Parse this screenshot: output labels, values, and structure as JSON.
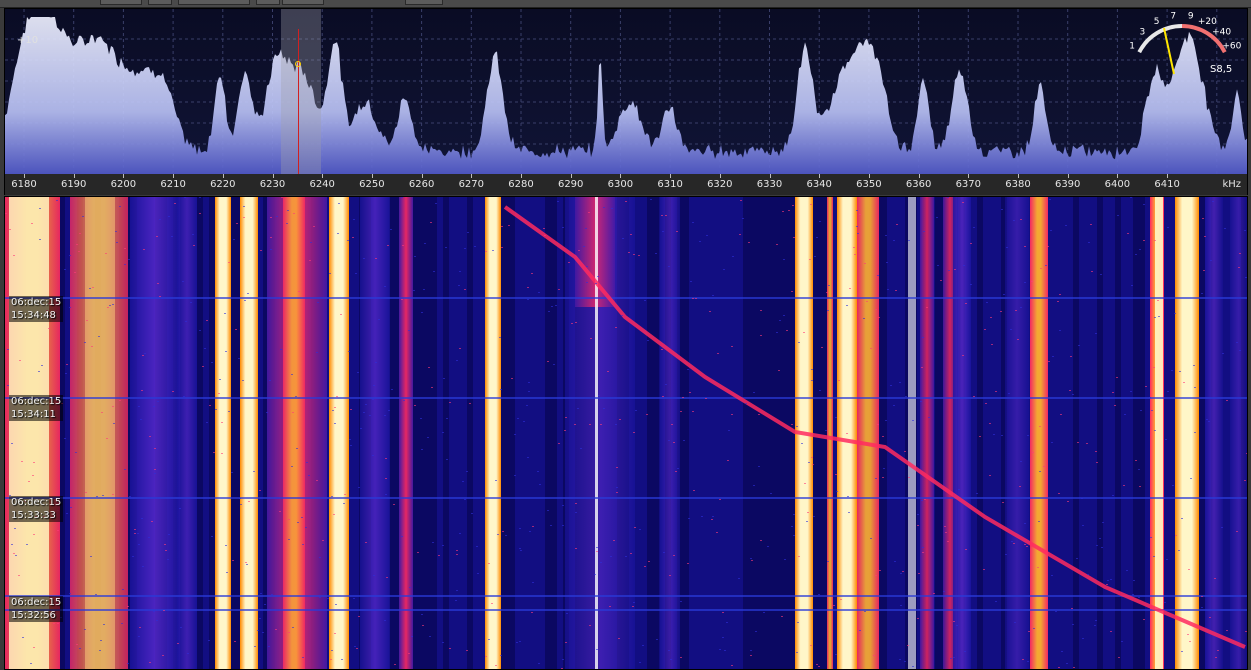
{
  "spectrum": {
    "db_label": "+10",
    "freq_unit": "kHz",
    "freq_ticks": [
      "6180",
      "6190",
      "6200",
      "6210",
      "6220",
      "6230",
      "6240",
      "6250",
      "6260",
      "6270",
      "6280",
      "6290",
      "6300",
      "6310",
      "6320",
      "6330",
      "6340",
      "6350",
      "6360",
      "6370",
      "6380",
      "6390",
      "6400",
      "6410"
    ]
  },
  "smeter": {
    "scale_labels": [
      "1",
      "3",
      "5",
      "7",
      "9",
      "+20",
      "+40",
      "+60"
    ],
    "reading": "S8,5"
  },
  "waterfall": {
    "timestamps": [
      {
        "date": "06:dec:15",
        "time": "15:34:48"
      },
      {
        "date": "06:dec:15",
        "time": "15:34:11"
      },
      {
        "date": "06:dec:15",
        "time": "15:33:33"
      },
      {
        "date": "06:dec:15",
        "time": "15:32:56"
      }
    ]
  },
  "colors": {
    "spectrum_fill": "#b8c0f4",
    "waterfall_bg": "#0d0a6e",
    "signal_hot": "#fff6c8",
    "signal_warm": "#ff9a20",
    "signal_mid": "#ff2a60",
    "tune_marker": "#d02020"
  }
}
